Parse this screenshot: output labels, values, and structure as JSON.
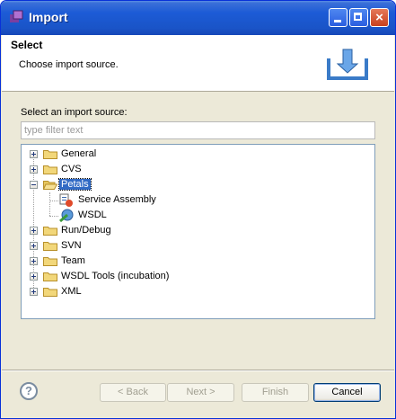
{
  "window": {
    "title": "Import"
  },
  "header": {
    "title": "Select",
    "description": "Choose import source."
  },
  "content": {
    "label": "Select an import source:",
    "filter_placeholder": "type filter text"
  },
  "tree": [
    {
      "label": "General",
      "state": "collapsed"
    },
    {
      "label": "CVS",
      "state": "collapsed"
    },
    {
      "label": "Petals",
      "state": "expanded",
      "selected": true,
      "children": [
        {
          "label": "Service Assembly",
          "icon": "service-assembly-icon"
        },
        {
          "label": "WSDL",
          "icon": "wsdl-icon"
        }
      ]
    },
    {
      "label": "Run/Debug",
      "state": "collapsed"
    },
    {
      "label": "SVN",
      "state": "collapsed"
    },
    {
      "label": "Team",
      "state": "collapsed"
    },
    {
      "label": "WSDL Tools (incubation)",
      "state": "collapsed"
    },
    {
      "label": "XML",
      "state": "collapsed"
    }
  ],
  "footer": {
    "help_glyph": "?",
    "back_label": "< Back",
    "next_label": "Next >",
    "finish_label": "Finish",
    "cancel_label": "Cancel"
  },
  "colors": {
    "selection": "#316ac5",
    "titlebar": "#1c5bd6",
    "folder": "#f2d77a"
  }
}
